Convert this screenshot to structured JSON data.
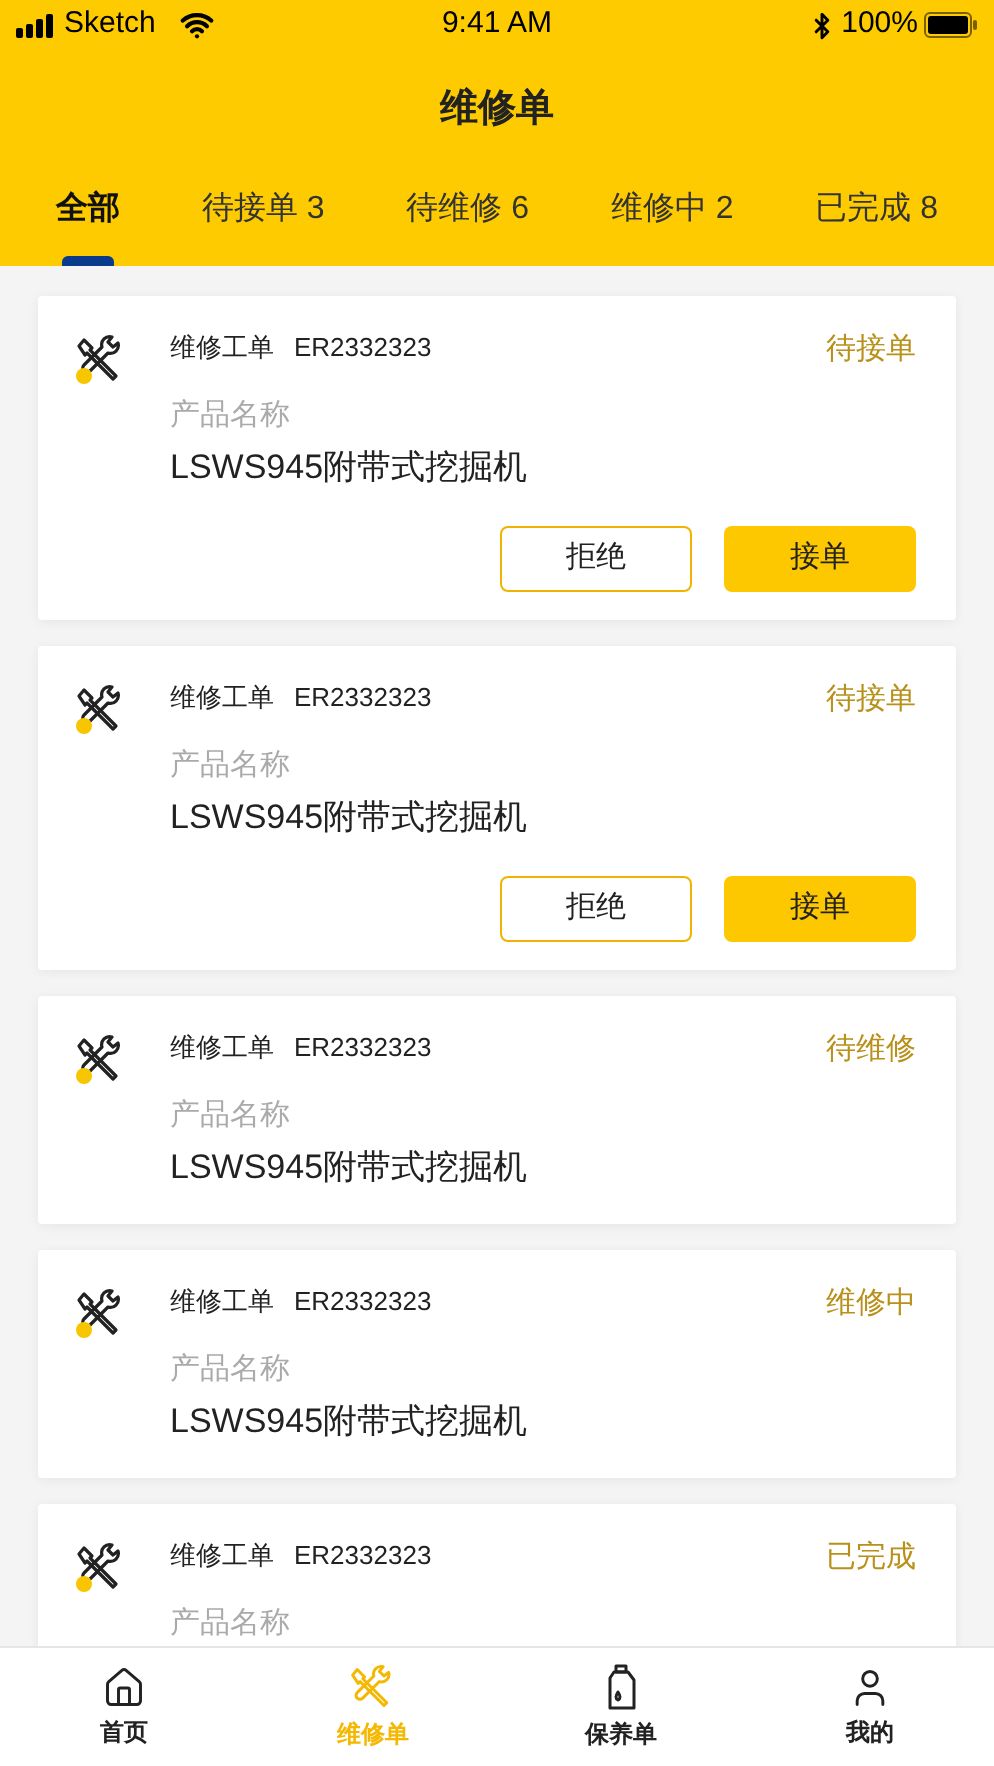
{
  "status_bar": {
    "carrier": "Sketch",
    "time": "9:41 AM",
    "battery": "100%"
  },
  "title": "维修单",
  "tabs": [
    {
      "label": "全部",
      "selected": true
    },
    {
      "label": "待接单 3",
      "selected": false
    },
    {
      "label": "待维修 6",
      "selected": false
    },
    {
      "label": "维修中 2",
      "selected": false
    },
    {
      "label": "已完成 8",
      "selected": false
    }
  ],
  "orders": [
    {
      "type_label": "维修工单",
      "number": "ER2332323",
      "status": "待接单",
      "product_label": "产品名称",
      "product_name": "LSWS945附带式挖掘机",
      "buttons": [
        {
          "label": "拒绝",
          "kind": "outline"
        },
        {
          "label": "接单",
          "kind": "filled"
        }
      ]
    },
    {
      "type_label": "维修工单",
      "number": "ER2332323",
      "status": "待接单",
      "product_label": "产品名称",
      "product_name": "LSWS945附带式挖掘机",
      "buttons": [
        {
          "label": "拒绝",
          "kind": "outline"
        },
        {
          "label": "接单",
          "kind": "filled"
        }
      ]
    },
    {
      "type_label": "维修工单",
      "number": "ER2332323",
      "status": "待维修",
      "product_label": "产品名称",
      "product_name": "LSWS945附带式挖掘机"
    },
    {
      "type_label": "维修工单",
      "number": "ER2332323",
      "status": "维修中",
      "product_label": "产品名称",
      "product_name": "LSWS945附带式挖掘机"
    },
    {
      "type_label": "维修工单",
      "number": "ER2332323",
      "status": "已完成",
      "product_label": "产品名称"
    }
  ],
  "bottom_nav": [
    {
      "label": "首页",
      "kind": "home",
      "selected": false
    },
    {
      "label": "维修单",
      "kind": "repair",
      "selected": true
    },
    {
      "label": "保养单",
      "kind": "bottle",
      "selected": false
    },
    {
      "label": "我的",
      "kind": "user",
      "selected": false
    }
  ]
}
